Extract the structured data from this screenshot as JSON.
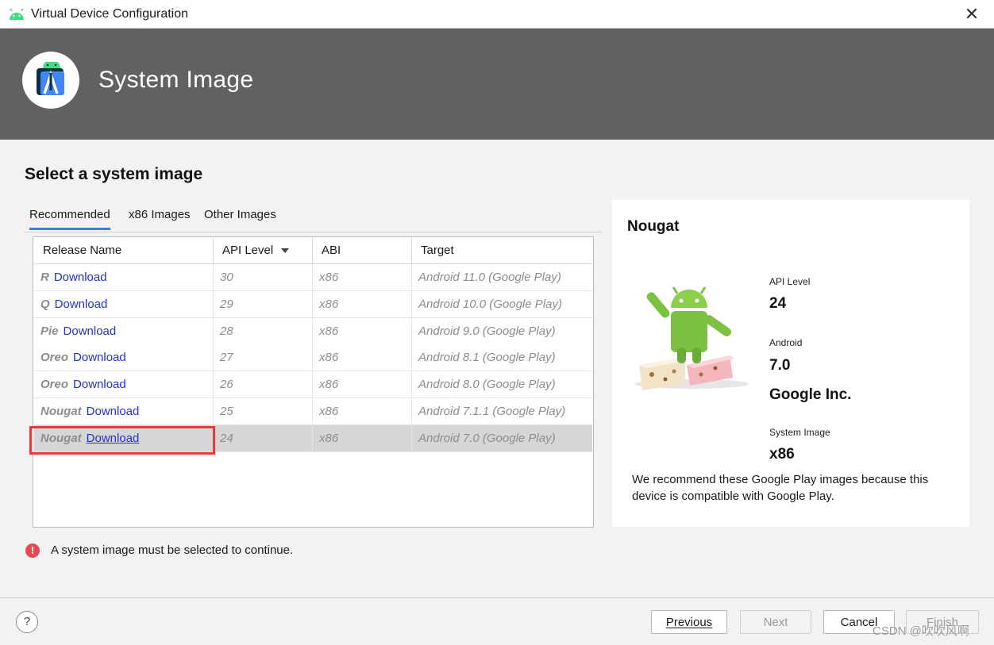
{
  "window": {
    "title": "Virtual Device Configuration"
  },
  "banner": {
    "title": "System Image"
  },
  "heading": "Select a system image",
  "tabs": [
    "Recommended",
    "x86 Images",
    "Other Images"
  ],
  "table": {
    "columns": [
      "Release Name",
      "API Level",
      "ABI",
      "Target"
    ],
    "rows": [
      {
        "name": "R",
        "action": "Download",
        "api": "30",
        "abi": "x86",
        "target": "Android 11.0 (Google Play)"
      },
      {
        "name": "Q",
        "action": "Download",
        "api": "29",
        "abi": "x86",
        "target": "Android 10.0 (Google Play)"
      },
      {
        "name": "Pie",
        "action": "Download",
        "api": "28",
        "abi": "x86",
        "target": "Android 9.0 (Google Play)"
      },
      {
        "name": "Oreo",
        "action": "Download",
        "api": "27",
        "abi": "x86",
        "target": "Android 8.1 (Google Play)"
      },
      {
        "name": "Oreo",
        "action": "Download",
        "api": "26",
        "abi": "x86",
        "target": "Android 8.0 (Google Play)"
      },
      {
        "name": "Nougat",
        "action": "Download",
        "api": "25",
        "abi": "x86",
        "target": "Android 7.1.1 (Google Play)"
      },
      {
        "name": "Nougat",
        "action": "Download",
        "api": "24",
        "abi": "x86",
        "target": "Android 7.0 (Google Play)"
      }
    ]
  },
  "details": {
    "title": "Nougat",
    "api_label": "API Level",
    "api_value": "24",
    "android_label": "Android",
    "android_value": "7.0",
    "vendor": "Google Inc.",
    "sysimg_label": "System Image",
    "sysimg_value": "x86",
    "recommendation": "We recommend these Google Play images because this device is compatible with Google Play."
  },
  "error": "A system image must be selected to continue.",
  "buttons": {
    "help": "?",
    "previous": "Previous",
    "next": "Next",
    "cancel": "Cancel",
    "finish": "Finish"
  },
  "watermark": "CSDN @吹吹风啊",
  "colors": {
    "banner": "#616161",
    "link": "#2132c8",
    "highlight": "#e8393b",
    "tab_underline": "#3f7dd6",
    "error": "#e84b4e"
  }
}
